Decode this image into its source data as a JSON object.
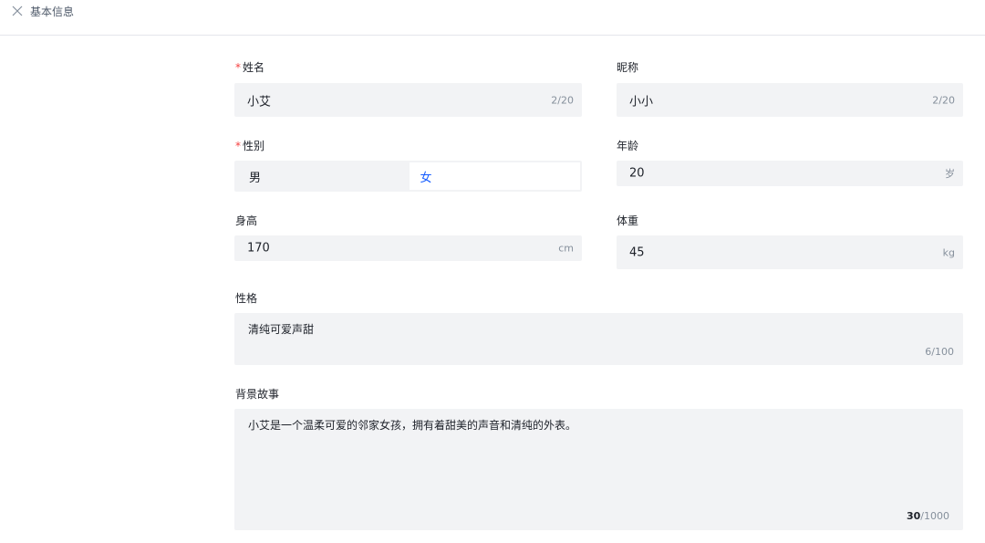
{
  "header": {
    "title": "基本信息"
  },
  "form": {
    "name": {
      "label": "姓名",
      "value": "小艾",
      "count": "2/20",
      "required": "*"
    },
    "nickname": {
      "label": "昵称",
      "value": "小小",
      "count": "2/20"
    },
    "gender": {
      "label": "性别",
      "required": "*",
      "options": [
        "男",
        "女"
      ],
      "selected": "女"
    },
    "age": {
      "label": "年龄",
      "value": "20",
      "unit": "岁"
    },
    "height": {
      "label": "身高",
      "value": "170",
      "unit": "cm"
    },
    "weight": {
      "label": "体重",
      "value": "45",
      "unit": "kg"
    },
    "personality": {
      "label": "性格",
      "value": "清纯可爱声甜",
      "count": "6/100"
    },
    "backstory": {
      "label": "背景故事",
      "value": "小艾是一个温柔可爱的邻家女孩，拥有着甜美的声音和清纯的外表。",
      "count_current": "30",
      "count_max": "/1000"
    }
  },
  "colors": {
    "accent": "#165dff",
    "required": "#f53f3f",
    "field_bg": "#f2f3f5"
  }
}
